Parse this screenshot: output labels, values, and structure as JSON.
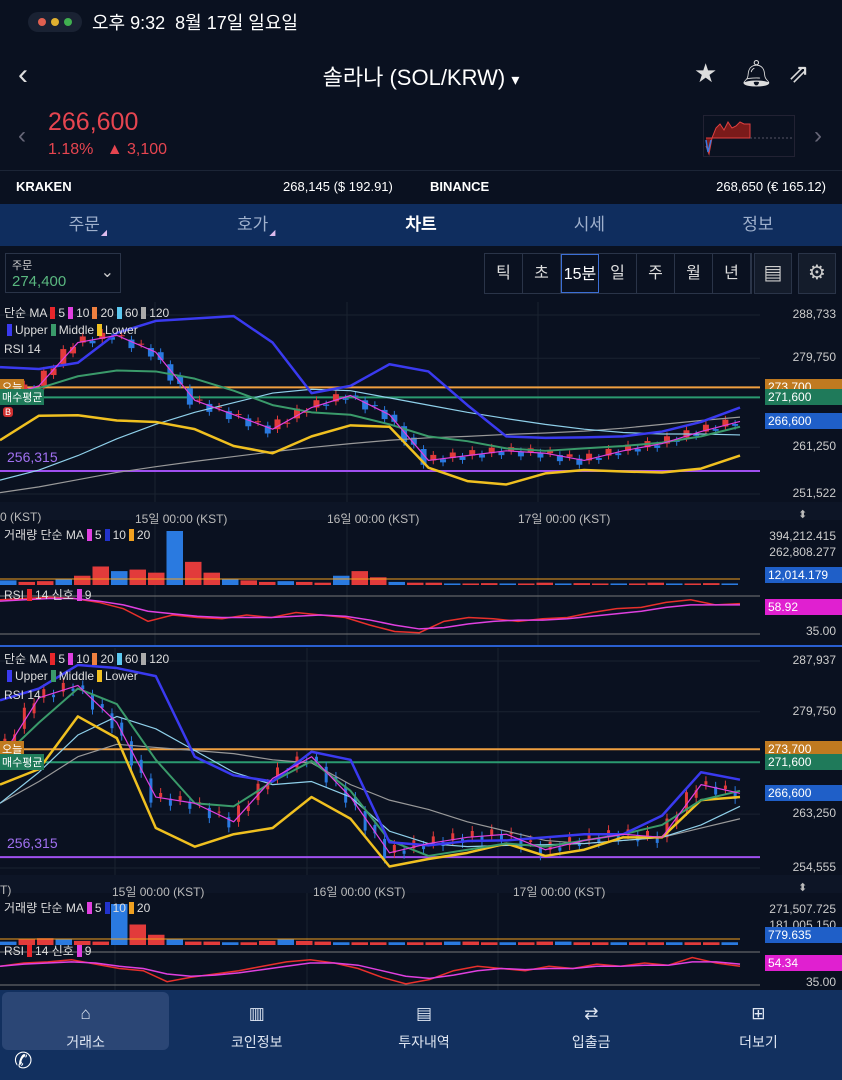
{
  "status": {
    "time": "오후 9:32",
    "date": "8월 17일 일요일"
  },
  "header": {
    "title": "솔라나 (SOL/KRW)",
    "dropdown": "▾"
  },
  "ticker": {
    "price": "266,600",
    "change_pct": "1.18%",
    "change_abs": "▲ 3,100",
    "color": "#e64550"
  },
  "exchanges": {
    "kraken_label": "KRAKEN",
    "kraken_value": "268,145 ($ 192.91)",
    "binance_label": "BINANCE",
    "binance_value": "268,650 (€ 165.12)"
  },
  "tabs": [
    "주문",
    "호가",
    "차트",
    "시세",
    "정보"
  ],
  "order": {
    "label": "주문",
    "value": "274,400"
  },
  "periods": [
    "틱",
    "초",
    "15분",
    "일",
    "주",
    "월",
    "년"
  ],
  "selected_period": "15분",
  "legend": {
    "ma": "단순 MA",
    "ma_items": [
      {
        "l": "5",
        "c": "#e8262b"
      },
      {
        "l": "10",
        "c": "#e040e0"
      },
      {
        "l": "20",
        "c": "#f08040"
      },
      {
        "l": "60",
        "c": "#5cc8f0"
      },
      {
        "l": "120",
        "c": "#aaaaaa"
      }
    ],
    "bb": [
      {
        "l": "Upper",
        "c": "#3a3af0"
      },
      {
        "l": "Middle",
        "c": "#3a9a6a"
      },
      {
        "l": "Lower",
        "c": "#f0c020"
      }
    ],
    "rsi": "RSI 14",
    "vol": "거래량 단순 MA",
    "vol_items": [
      {
        "l": "5",
        "c": "#e040e0"
      },
      {
        "l": "10",
        "c": "#2233cc"
      },
      {
        "l": "20",
        "c": "#f0a020"
      }
    ],
    "rsi_sig": "RSI",
    "rsi_items": [
      {
        "l": "14 신호",
        "c": "#e8262b"
      },
      {
        "l": "9",
        "c": "#e040e0"
      }
    ]
  },
  "lines": {
    "today": "오늘",
    "avg": "매수평균",
    "low_label": "256,315",
    "b": "B"
  },
  "chart_data": [
    {
      "type": "line",
      "name": "upper-panel",
      "ylim": [
        251522,
        288733
      ],
      "yticks": [
        "288,733",
        "279,750",
        "261,250",
        "251,522"
      ],
      "ytick_vals": [
        288733,
        279750,
        261250,
        251522
      ],
      "xticks": [
        "0 (KST)",
        "15일 00:00 (KST)",
        "16일 00:00 (KST)",
        "17일 00:00 (KST)"
      ],
      "tags": {
        "today": 273700,
        "today_label": "273,700",
        "avg": 271600,
        "avg_label": "271,600",
        "current": 266600,
        "current_label": "266,600",
        "low": 256315
      },
      "series": {
        "upper": [
          277900,
          277500,
          278800,
          285000,
          287500,
          288000,
          288500,
          283000,
          272500,
          274000,
          278500,
          277000,
          270000,
          263500,
          263200,
          263300,
          263500,
          264500,
          266500,
          269500
        ],
        "middle": [
          272000,
          273500,
          276000,
          277200,
          277000,
          275500,
          273000,
          270000,
          268500,
          268000,
          266000,
          263500,
          262500,
          261000,
          260500,
          261000,
          261500,
          262200,
          263500,
          265500
        ],
        "lower": [
          262700,
          267800,
          267900,
          266800,
          266500,
          265000,
          261500,
          260000,
          263500,
          265800,
          265500,
          257000,
          254200,
          253500,
          255800,
          256500,
          256200,
          256000,
          256800,
          259500
        ],
        "ma60": [
          254400,
          256500,
          259500,
          263000,
          266000,
          268500,
          270500,
          272500,
          273300,
          273000,
          271500,
          270000,
          268500,
          267200,
          266000,
          265000,
          264300,
          264000,
          264000,
          263800
        ],
        "ma120": [
          251800,
          253000,
          254500,
          256000,
          257200,
          258300,
          259300,
          260300,
          261200,
          262000,
          262700,
          263200,
          263500,
          263900,
          264200,
          264600,
          265200,
          266000,
          266800,
          267500
        ],
        "close": [
          271500,
          274000,
          283000,
          284500,
          281000,
          271000,
          268000,
          265000,
          269500,
          272000,
          268000,
          258500,
          259500,
          260500,
          260000,
          258500,
          260500,
          262000,
          264500,
          266600
        ]
      },
      "volume": {
        "ticks": [
          "394,212.415",
          "262,808.277"
        ],
        "current": "12,014.179",
        "values": [
          30,
          20,
          25,
          40,
          60,
          120,
          90,
          100,
          80,
          350,
          150,
          80,
          40,
          30,
          20,
          25,
          20,
          15,
          60,
          90,
          50,
          20,
          15,
          15,
          10,
          10,
          12,
          10,
          10,
          15,
          10,
          12,
          10,
          10,
          10,
          15,
          10,
          10,
          12,
          10
        ]
      },
      "rsi": {
        "ticks": [
          "35.00"
        ],
        "current": "58.92",
        "values": [
          62,
          63,
          64,
          63,
          60,
          55,
          45,
          50,
          48,
          47,
          50,
          48,
          52,
          50,
          48,
          42,
          37,
          36,
          45,
          48,
          47,
          45,
          47,
          48,
          52,
          55,
          56,
          60,
          62,
          58,
          59
        ],
        "signal": [
          61,
          62,
          63,
          63,
          61,
          58,
          53,
          51,
          49,
          48,
          48,
          48,
          49,
          50,
          49,
          46,
          42,
          39,
          40,
          43,
          45,
          46,
          46,
          47,
          49,
          51,
          53,
          56,
          58,
          58,
          58
        ]
      }
    },
    {
      "type": "line",
      "name": "lower-panel",
      "ylim": [
        254555,
        287937
      ],
      "yticks": [
        "287,937",
        "279,750",
        "263,250",
        "254,555"
      ],
      "ytick_vals": [
        287937,
        279750,
        263250,
        254555
      ],
      "xticks": [
        "T)",
        "15일 00:00 (KST)",
        "16일 00:00 (KST)",
        "17일 00:00 (KST)"
      ],
      "tags": {
        "today": 273700,
        "today_label": "273,700",
        "avg": 271600,
        "avg_label": "271,600",
        "current": 266600,
        "current_label": "266,600",
        "low": 256315
      },
      "series": {
        "upper": [
          281600,
          283500,
          287300,
          286800,
          285500,
          272500,
          269500,
          268500,
          273300,
          272000,
          258700,
          258200,
          258900,
          259000,
          259500,
          260000,
          260000,
          263000,
          270000,
          268800
        ],
        "middle": [
          272000,
          278000,
          283500,
          281000,
          272000,
          265000,
          264500,
          268500,
          271800,
          267000,
          259000,
          256500,
          257500,
          258500,
          258000,
          259000,
          260000,
          261500,
          265500,
          267000
        ],
        "lower": [
          268000,
          270500,
          279000,
          275500,
          261000,
          258000,
          260000,
          261000,
          266000,
          262500,
          254800,
          256000,
          257000,
          258500,
          256500,
          257500,
          259500,
          259500,
          265500,
          266000
        ],
        "ma60": [
          265000,
          270000,
          276000,
          279000,
          277000,
          273500,
          270000,
          268000,
          268500,
          266000,
          260500,
          258500,
          258000,
          258200,
          258300,
          258500,
          259000,
          259500,
          261500,
          264500
        ],
        "ma120": [
          265000,
          268500,
          272500,
          274500,
          274000,
          273500,
          273000,
          272000,
          271500,
          268000,
          265500,
          264000,
          262000,
          260500,
          259000,
          258500,
          259000,
          259500,
          261000,
          262500
        ],
        "close": [
          272000,
          282000,
          284000,
          278000,
          266000,
          265000,
          262000,
          269000,
          272500,
          266000,
          257000,
          258500,
          259500,
          260000,
          257500,
          259000,
          260000,
          259500,
          268000,
          266600
        ]
      },
      "volume": {
        "ticks": [
          "271,507.725",
          "181,005.150"
        ],
        "current": "779.635",
        "values": [
          5,
          8,
          10,
          8,
          6,
          5,
          60,
          30,
          15,
          8,
          5,
          5,
          4,
          4,
          6,
          8,
          6,
          5,
          4,
          4,
          4,
          4,
          4,
          4,
          5,
          5,
          4,
          4,
          4,
          5,
          5,
          4,
          4,
          4,
          4,
          4,
          4,
          4,
          4,
          4
        ]
      },
      "rsi": {
        "ticks": [
          "35.00"
        ],
        "current": "54.34",
        "values": [
          52,
          55,
          56,
          58,
          54,
          50,
          48,
          38,
          42,
          45,
          48,
          52,
          56,
          58,
          55,
          50,
          42,
          36,
          40,
          48,
          52,
          50,
          48,
          52,
          50,
          54,
          52,
          55,
          53,
          60,
          55,
          52
        ],
        "signal": [
          52,
          54,
          55,
          56,
          55,
          52,
          50,
          45,
          43,
          44,
          46,
          49,
          52,
          55,
          55,
          53,
          48,
          43,
          41,
          44,
          48,
          50,
          49,
          50,
          50,
          52,
          52,
          53,
          53,
          56,
          56,
          54
        ]
      }
    }
  ],
  "bottom_nav": [
    {
      "label": "거래소",
      "icon": "⌂"
    },
    {
      "label": "코인정보",
      "icon": "▥"
    },
    {
      "label": "투자내역",
      "icon": "▤"
    },
    {
      "label": "입출금",
      "icon": "⇄"
    },
    {
      "label": "더보기",
      "icon": "⊞"
    }
  ]
}
